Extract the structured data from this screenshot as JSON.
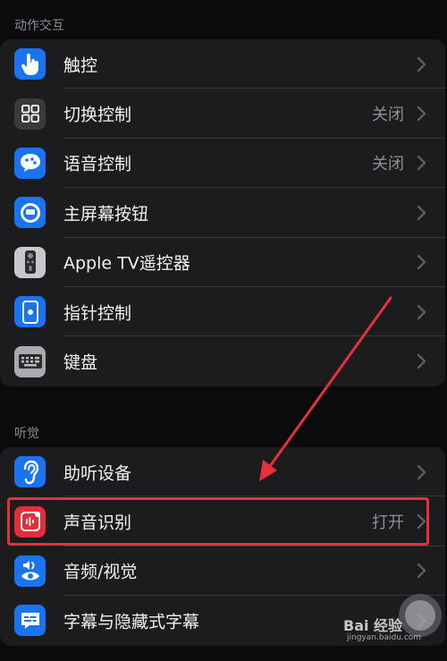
{
  "sections": {
    "interaction": {
      "header": "动作交互",
      "items": [
        {
          "label": "触控",
          "value": "",
          "icon": "hand-pointer-icon",
          "color": "#1a73f0"
        },
        {
          "label": "切换控制",
          "value": "关闭",
          "icon": "switch-control-grid-icon",
          "color": "#3a3a3d"
        },
        {
          "label": "语音控制",
          "value": "关闭",
          "icon": "voice-control-icon",
          "color": "#1a73f0"
        },
        {
          "label": "主屏幕按钮",
          "value": "",
          "icon": "home-button-icon",
          "color": "#1a73f0"
        },
        {
          "label": "Apple TV遥控器",
          "value": "",
          "icon": "tv-remote-icon",
          "color": "#c8c8cc"
        },
        {
          "label": "指针控制",
          "value": "",
          "icon": "pointer-control-icon",
          "color": "#1a73f0"
        },
        {
          "label": "键盘",
          "value": "",
          "icon": "keyboard-icon",
          "color": "#a9a9ae"
        }
      ]
    },
    "hearing": {
      "header": "听觉",
      "items": [
        {
          "label": "助听设备",
          "value": "",
          "icon": "ear-icon",
          "color": "#1a73f0"
        },
        {
          "label": "声音识别",
          "value": "打开",
          "icon": "sound-recognition-icon",
          "color": "#e52d3a"
        },
        {
          "label": "音频/视觉",
          "value": "",
          "icon": "audio-visual-icon",
          "color": "#1a73f0"
        },
        {
          "label": "字幕与隐藏式字幕",
          "value": "",
          "icon": "subtitles-icon",
          "color": "#1a73f0"
        }
      ]
    }
  },
  "watermark": {
    "brand": "Bai 经验",
    "url": "jingyan.baidu.com"
  },
  "annotation_color": "#e8303c"
}
